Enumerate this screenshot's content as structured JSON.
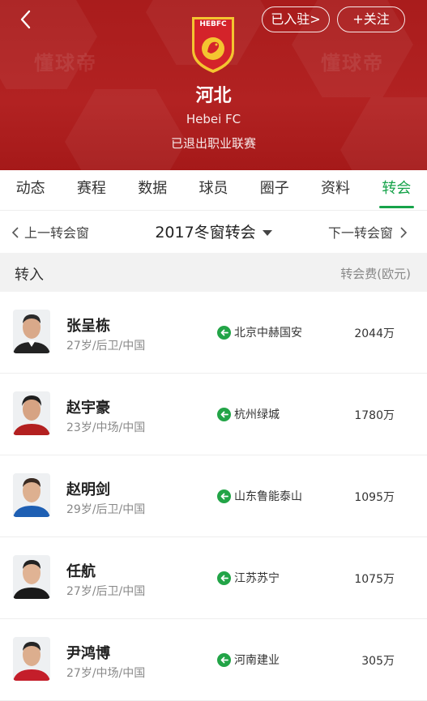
{
  "header": {
    "back_icon": "chevron-left-icon",
    "settled_label": "已入驻>",
    "follow_label": "+关注",
    "crest_text": "HEBFC",
    "team_name": "河北",
    "team_name_en": "Hebei FC",
    "status": "已退出职业联赛",
    "watermark": "懂球帝",
    "colors": {
      "header_bg": "#b22222",
      "crest_red": "#d4232a",
      "crest_gold": "#f4c430"
    }
  },
  "tabs": [
    {
      "label": "动态",
      "active": false
    },
    {
      "label": "赛程",
      "active": false
    },
    {
      "label": "数据",
      "active": false
    },
    {
      "label": "球员",
      "active": false
    },
    {
      "label": "圈子",
      "active": false
    },
    {
      "label": "资料",
      "active": false
    },
    {
      "label": "转会",
      "active": true
    }
  ],
  "window_nav": {
    "prev_label": "上一转会窗",
    "title": "2017冬窗转会",
    "next_label": "下一转会窗"
  },
  "section": {
    "title": "转入",
    "fee_header": "转会费(欧元)"
  },
  "transfers": [
    {
      "name": "张呈栋",
      "info": "27岁/后卫/中国",
      "from": "北京中赫国安",
      "fee": "2044万"
    },
    {
      "name": "赵宇豪",
      "info": "23岁/中场/中国",
      "from": "杭州绿城",
      "fee": "1780万"
    },
    {
      "name": "赵明剑",
      "info": "29岁/后卫/中国",
      "from": "山东鲁能泰山",
      "fee": "1095万"
    },
    {
      "name": "任航",
      "info": "27岁/后卫/中国",
      "from": "江苏苏宁",
      "fee": "1075万"
    },
    {
      "name": "尹鸿博",
      "info": "27岁/中场/中国",
      "from": "河南建业",
      "fee": "305万"
    }
  ],
  "accent_color": "#16a34a"
}
